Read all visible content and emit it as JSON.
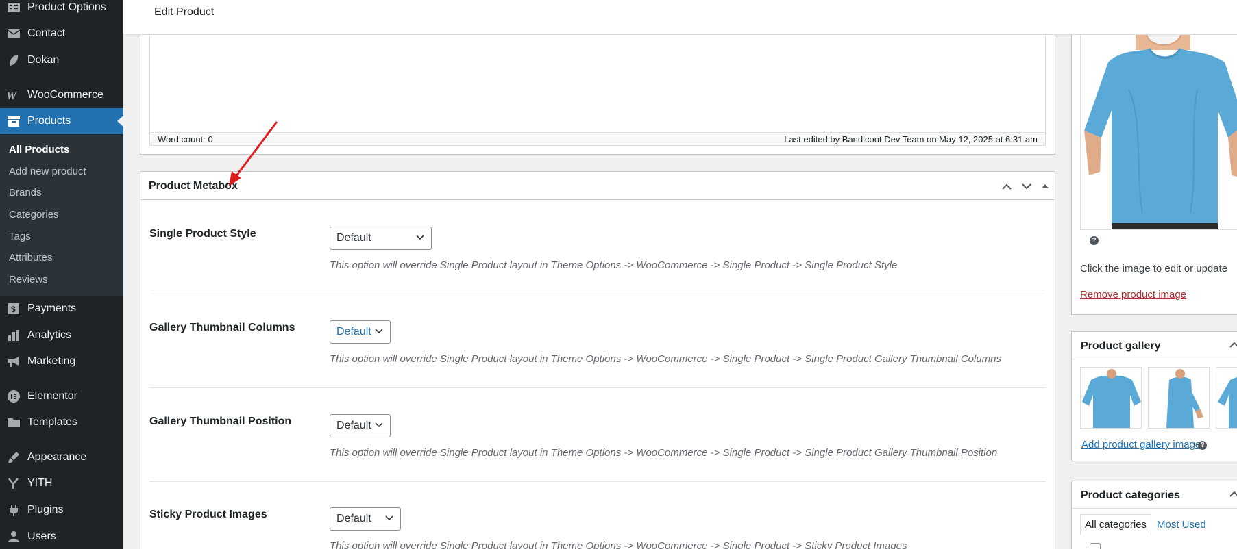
{
  "header": {
    "title": "Edit Product"
  },
  "sidebar": {
    "items": [
      {
        "label": "Product Options",
        "icon": "product-options-icon"
      },
      {
        "label": "Contact",
        "icon": "mail-icon"
      },
      {
        "label": "Dokan",
        "icon": "dokan-icon"
      },
      {
        "label": "WooCommerce",
        "icon": "woocommerce-icon"
      },
      {
        "label": "Products",
        "icon": "products-archive-icon",
        "active": true
      },
      {
        "label": "Payments",
        "icon": "payments-icon"
      },
      {
        "label": "Analytics",
        "icon": "analytics-icon"
      },
      {
        "label": "Marketing",
        "icon": "megaphone-icon"
      },
      {
        "label": "Elementor",
        "icon": "elementor-icon"
      },
      {
        "label": "Templates",
        "icon": "folder-icon"
      },
      {
        "label": "Appearance",
        "icon": "paintbrush-icon"
      },
      {
        "label": "YITH",
        "icon": "yith-icon"
      },
      {
        "label": "Plugins",
        "icon": "plug-icon"
      },
      {
        "label": "Users",
        "icon": "users-icon"
      }
    ],
    "submenu": [
      "All Products",
      "Add new product",
      "Brands",
      "Categories",
      "Tags",
      "Attributes",
      "Reviews"
    ]
  },
  "editor": {
    "word_count": "Word count: 0",
    "last_edited": "Last edited by Bandicoot Dev Team on May 12, 2025 at 6:31 am"
  },
  "metabox": {
    "title": "Product Metabox",
    "options": [
      {
        "label": "Single Product Style",
        "value": "Default",
        "description": "This option will override Single Product layout in Theme Options -> WooCommerce -> Single Product -> Single Product Style"
      },
      {
        "label": "Gallery Thumbnail Columns",
        "value": "Default",
        "description": "This option will override Single Product layout in Theme Options -> WooCommerce -> Single Product -> Single Product Gallery Thumbnail Columns"
      },
      {
        "label": "Gallery Thumbnail Position",
        "value": "Default",
        "description": "This option will override Single Product layout in Theme Options -> WooCommerce -> Single Product -> Single Product Gallery Thumbnail Position"
      },
      {
        "label": "Sticky Product Images",
        "value": "Default",
        "description": "This option will override Single Product layout in Theme Options -> WooCommerce -> Single Product -> Sticky Product Images"
      }
    ]
  },
  "product_image": {
    "hint": "Click the image to edit or update",
    "remove_link": "Remove product image"
  },
  "gallery": {
    "title": "Product gallery",
    "add_link": "Add product gallery images"
  },
  "categories": {
    "title": "Product categories",
    "tabs": [
      "All categories",
      "Most Used"
    ]
  },
  "colors": {
    "sidebar_bg": "#1d2327",
    "accent": "#2271b1",
    "link": "#2271b1",
    "danger_link": "#b32d2e",
    "shirt": "#5aa9d6",
    "annotation_arrow": "#e01e1e"
  }
}
